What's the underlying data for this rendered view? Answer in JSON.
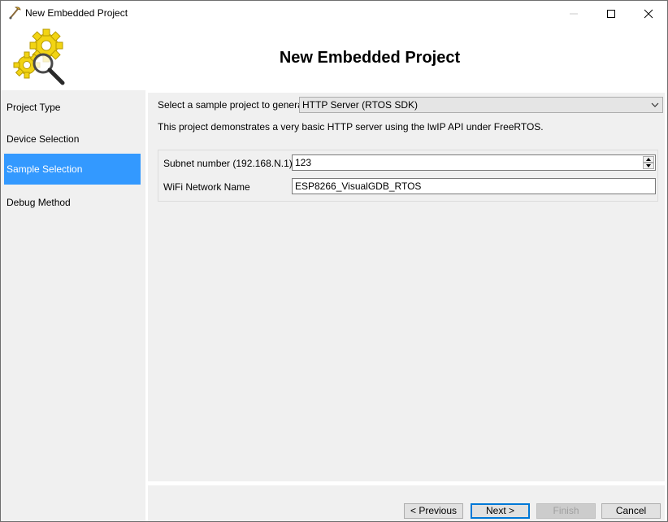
{
  "window": {
    "title": "New Embedded Project"
  },
  "header": {
    "title": "New Embedded Project"
  },
  "sidebar": {
    "items": [
      {
        "label": "Project Type",
        "active": false
      },
      {
        "label": "Device Selection",
        "active": false
      },
      {
        "label": "Sample Selection",
        "active": true
      },
      {
        "label": "Debug Method",
        "active": false
      }
    ]
  },
  "main": {
    "select_label": "Select a sample project to generate:",
    "select_value": "HTTP Server (RTOS SDK)",
    "description": "This project demonstrates a very basic HTTP server using the lwIP API under FreeRTOS.",
    "params": [
      {
        "label": "Subnet number (192.168.N.1)",
        "value": "123"
      },
      {
        "label": "WiFi Network Name",
        "value": "ESP8266_VisualGDB_RTOS"
      }
    ]
  },
  "buttons": {
    "previous": "< Previous",
    "next": "Next >",
    "finish": "Finish",
    "cancel": "Cancel"
  },
  "colors": {
    "accent": "#3399ff",
    "panel": "#f0f0f0",
    "gear": "#f2d413"
  }
}
